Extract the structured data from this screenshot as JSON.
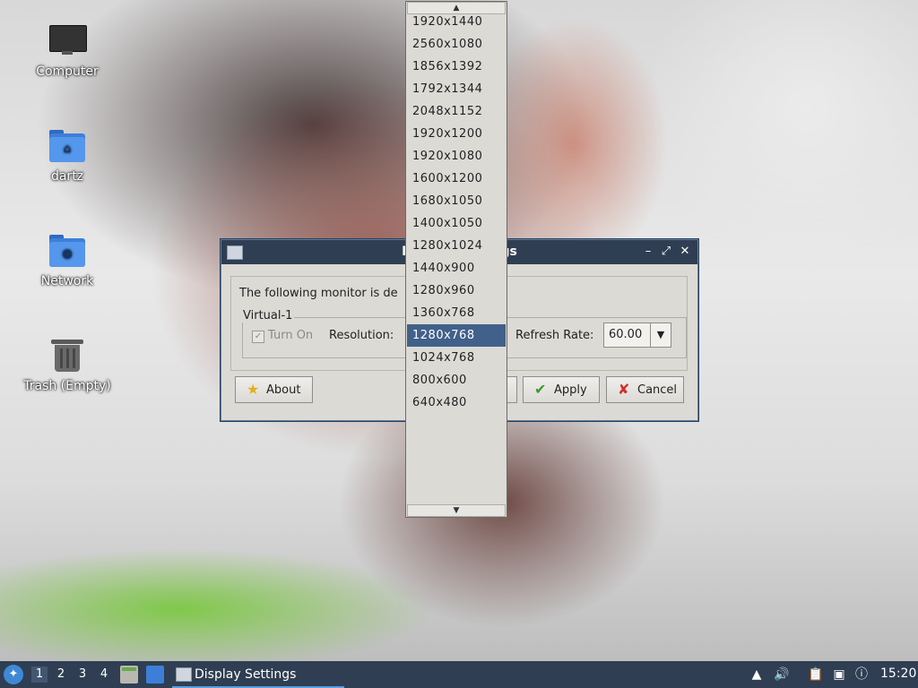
{
  "desktop": {
    "icons": [
      {
        "label": "Computer"
      },
      {
        "label": "dartz"
      },
      {
        "label": "Network"
      },
      {
        "label": "Trash (Empty)"
      }
    ]
  },
  "dialog": {
    "title": "Display Settings",
    "info_text": "The following monitor is de",
    "monitor_name": "Virtual-1",
    "turn_on_label": "Turn On",
    "turn_on_checked": true,
    "resolution_label": "Resolution:",
    "refresh_rate_label": "Refresh Rate:",
    "refresh_rate_value": "60.00",
    "buttons": {
      "about": "About",
      "apply": "Apply",
      "cancel": "Cancel"
    }
  },
  "resolution_dropdown": {
    "selected": "1280x768",
    "options": [
      "1920x1440",
      "2560x1080",
      "1856x1392",
      "1792x1344",
      "2048x1152",
      "1920x1200",
      "1920x1080",
      "1600x1200",
      "1680x1050",
      "1400x1050",
      "1280x1024",
      "1440x900",
      "1280x960",
      "1360x768",
      "1280x768",
      "1024x768",
      "800x600",
      "640x480"
    ]
  },
  "taskbar": {
    "workspaces": [
      "1",
      "2",
      "3",
      "4"
    ],
    "active_workspace": "1",
    "task_title": "Display Settings",
    "clock": "15:20"
  },
  "colors": {
    "titlebar": "#2f3e52",
    "selection": "#41618a",
    "dialog_bg": "#dcdad5"
  }
}
